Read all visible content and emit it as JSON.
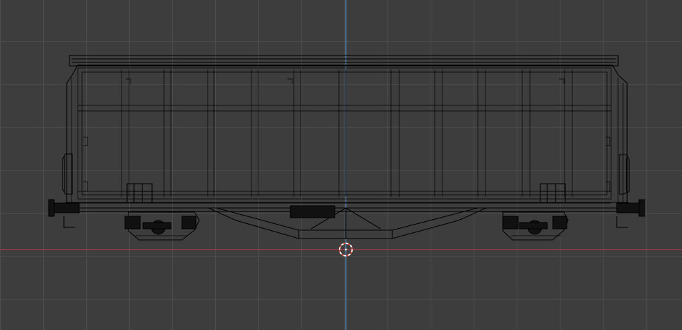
{
  "viewport": {
    "view": "front-orthographic-wireframe",
    "background_color": "#3d3d3d",
    "grid_color": "#505050",
    "x_axis_color": "#9b3b46",
    "z_axis_color": "#4f79a6",
    "wire_color": "#000000",
    "cursor_colors": [
      "#ffffff",
      "#d94b3a"
    ]
  },
  "object": {
    "name": "covered-freight-wagon",
    "type": "wireframe-mesh"
  },
  "icons": {
    "cursor": "3d-cursor-icon"
  }
}
